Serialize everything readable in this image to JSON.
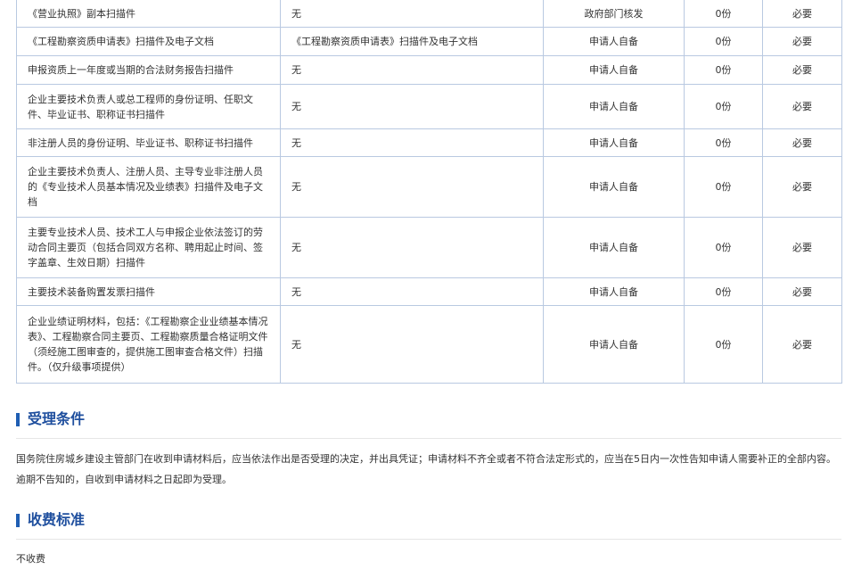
{
  "materials": {
    "rows": [
      {
        "name": "《营业执照》副本扫描件",
        "sample": "无",
        "source": "政府部门核发",
        "copies": "0份",
        "required": "必要"
      },
      {
        "name": "《工程勘察资质申请表》扫描件及电子文档",
        "sample": "《工程勘察资质申请表》扫描件及电子文档",
        "source": "申请人自备",
        "copies": "0份",
        "required": "必要"
      },
      {
        "name": "申报资质上一年度或当期的合法财务报告扫描件",
        "sample": "无",
        "source": "申请人自备",
        "copies": "0份",
        "required": "必要"
      },
      {
        "name": "企业主要技术负责人或总工程师的身份证明、任职文件、毕业证书、职称证书扫描件",
        "sample": "无",
        "source": "申请人自备",
        "copies": "0份",
        "required": "必要"
      },
      {
        "name": "非注册人员的身份证明、毕业证书、职称证书扫描件",
        "sample": "无",
        "source": "申请人自备",
        "copies": "0份",
        "required": "必要"
      },
      {
        "name": "企业主要技术负责人、注册人员、主导专业非注册人员的《专业技术人员基本情况及业绩表》扫描件及电子文档",
        "sample": "无",
        "source": "申请人自备",
        "copies": "0份",
        "required": "必要"
      },
      {
        "name": "主要专业技术人员、技术工人与申报企业依法签订的劳动合同主要页（包括合同双方名称、聘用起止时间、签字盖章、生效日期）扫描件",
        "sample": "无",
        "source": "申请人自备",
        "copies": "0份",
        "required": "必要"
      },
      {
        "name": "主要技术装备购置发票扫描件",
        "sample": "无",
        "source": "申请人自备",
        "copies": "0份",
        "required": "必要"
      },
      {
        "name": "企业业绩证明材料，包括：《工程勘察企业业绩基本情况表》、工程勘察合同主要页、工程勘察质量合格证明文件（须经施工图审查的，提供施工图审查合格文件）扫描件。（仅升级事项提供）",
        "sample": "无",
        "source": "申请人自备",
        "copies": "0份",
        "required": "必要"
      }
    ]
  },
  "acceptance": {
    "title": "受理条件",
    "text": "国务院住房城乡建设主管部门在收到申请材料后，应当依法作出是否受理的决定，并出具凭证；申请材料不齐全或者不符合法定形式的，应当在5日内一次性告知申请人需要补正的全部内容。逾期不告知的，自收到申请材料之日起即为受理。"
  },
  "fees": {
    "title": "收费标准",
    "text": "不收费"
  },
  "colors": {
    "accent": "#1f5eb3",
    "title": "#1f4f9e",
    "border": "#b9c9e1"
  }
}
